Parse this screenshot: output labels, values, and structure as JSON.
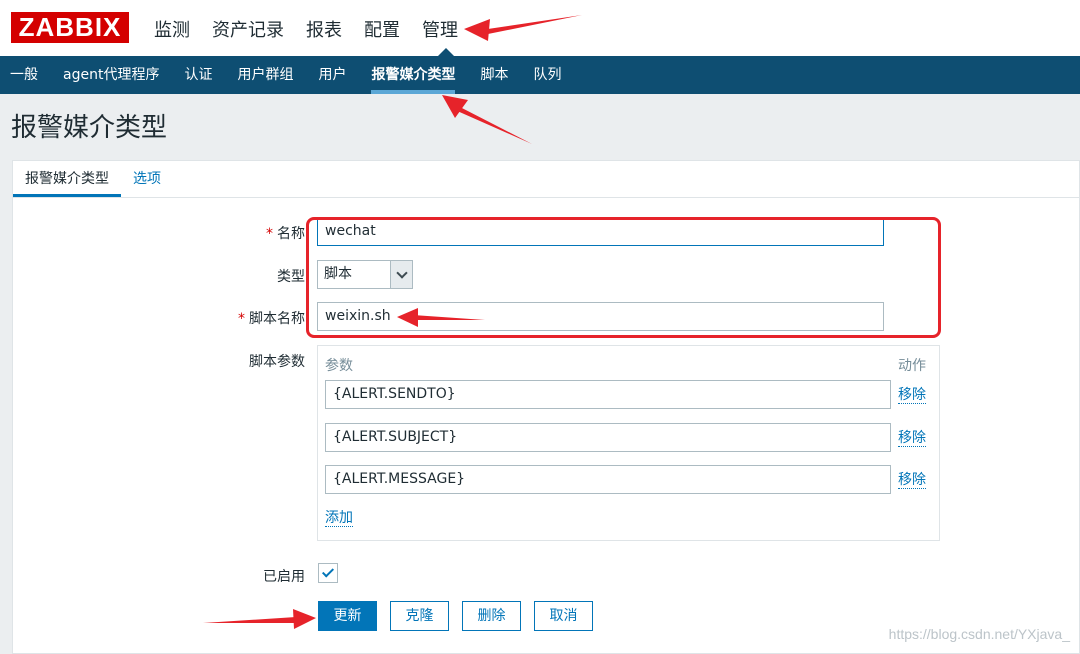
{
  "app": {
    "logo": "ZABBIX"
  },
  "top_menu": [
    {
      "label": "监测"
    },
    {
      "label": "资产记录"
    },
    {
      "label": "报表"
    },
    {
      "label": "配置"
    },
    {
      "label": "管理",
      "active": true
    }
  ],
  "sub_menu": [
    {
      "label": "一般"
    },
    {
      "label": "agent代理程序"
    },
    {
      "label": "认证"
    },
    {
      "label": "用户群组"
    },
    {
      "label": "用户"
    },
    {
      "label": "报警媒介类型",
      "active": true
    },
    {
      "label": "脚本"
    },
    {
      "label": "队列"
    }
  ],
  "page": {
    "title": "报警媒介类型"
  },
  "tabs": [
    {
      "label": "报警媒介类型",
      "active": true
    },
    {
      "label": "选项"
    }
  ],
  "form": {
    "name_label": "名称",
    "name_value": "wechat",
    "type_label": "类型",
    "type_value": "脚本",
    "script_name_label": "脚本名称",
    "script_name_value": "weixin.sh",
    "script_params_label": "脚本参数",
    "params_header_param": "参数",
    "params_header_action": "动作",
    "params": [
      {
        "value": "{ALERT.SENDTO}",
        "remove": "移除"
      },
      {
        "value": "{ALERT.SUBJECT}",
        "remove": "移除"
      },
      {
        "value": "{ALERT.MESSAGE}",
        "remove": "移除"
      }
    ],
    "add_label": "添加",
    "enabled_label": "已启用",
    "enabled": true,
    "required_mark": "*"
  },
  "buttons": {
    "update": "更新",
    "clone": "克隆",
    "delete": "删除",
    "cancel": "取消"
  },
  "watermark": "https://blog.csdn.net/YXjava_",
  "colors": {
    "brand_red": "#d40000",
    "nav_blue": "#0e4e72",
    "accent": "#0275b8",
    "annotation_red": "#e6232a"
  }
}
